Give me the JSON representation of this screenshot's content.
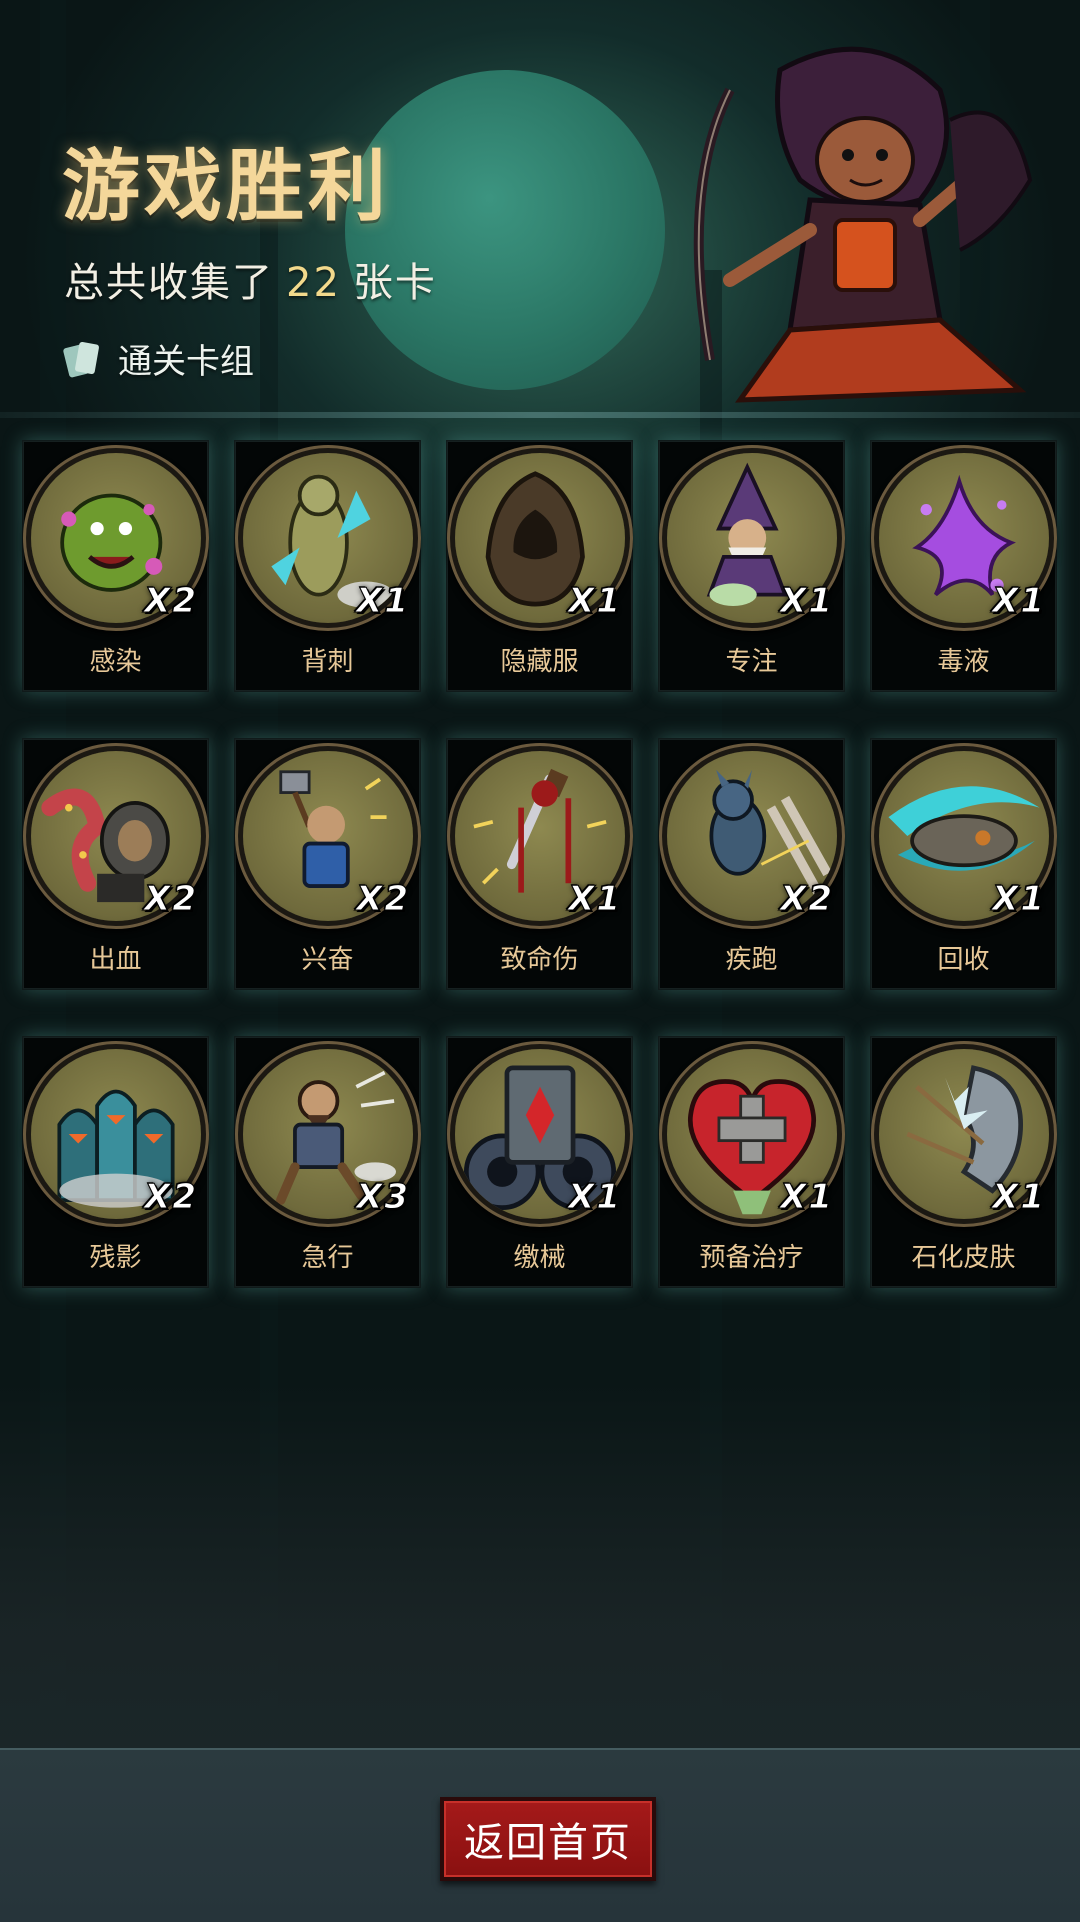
{
  "header": {
    "title": "游戏胜利",
    "summary_prefix": "总共收集了",
    "summary_count": "22",
    "summary_suffix": "张卡",
    "deck_label": "通关卡组"
  },
  "cards": [
    {
      "name": "感染",
      "qty": "X2",
      "icon": "plague-monster-icon"
    },
    {
      "name": "背刺",
      "qty": "X1",
      "icon": "backstab-dummy-icon"
    },
    {
      "name": "隐藏服",
      "qty": "X1",
      "icon": "hooded-cloak-icon"
    },
    {
      "name": "专注",
      "qty": "X1",
      "icon": "wizard-icon"
    },
    {
      "name": "毒液",
      "qty": "X1",
      "icon": "venom-splash-icon"
    },
    {
      "name": "出血",
      "qty": "X2",
      "icon": "tentacle-monster-icon"
    },
    {
      "name": "兴奋",
      "qty": "X2",
      "icon": "hammer-dwarf-icon"
    },
    {
      "name": "致命伤",
      "qty": "X1",
      "icon": "bleeding-dagger-icon"
    },
    {
      "name": "疾跑",
      "qty": "X2",
      "icon": "running-wolf-icon"
    },
    {
      "name": "回收",
      "qty": "X1",
      "icon": "spinning-blade-icon"
    },
    {
      "name": "残影",
      "qty": "X2",
      "icon": "shadow-clones-icon"
    },
    {
      "name": "急行",
      "qty": "X3",
      "icon": "dashing-warrior-icon"
    },
    {
      "name": "缴械",
      "qty": "X1",
      "icon": "gear-card-icon"
    },
    {
      "name": "预备治疗",
      "qty": "X1",
      "icon": "heart-cross-icon"
    },
    {
      "name": "石化皮肤",
      "qty": "X1",
      "icon": "stone-arm-icon"
    }
  ],
  "footer": {
    "home_button": "返回首页"
  },
  "colors": {
    "title": "#f4d79a",
    "count": "#f2d98c",
    "card_name": "#e7c898",
    "button": "#a51a1a"
  }
}
